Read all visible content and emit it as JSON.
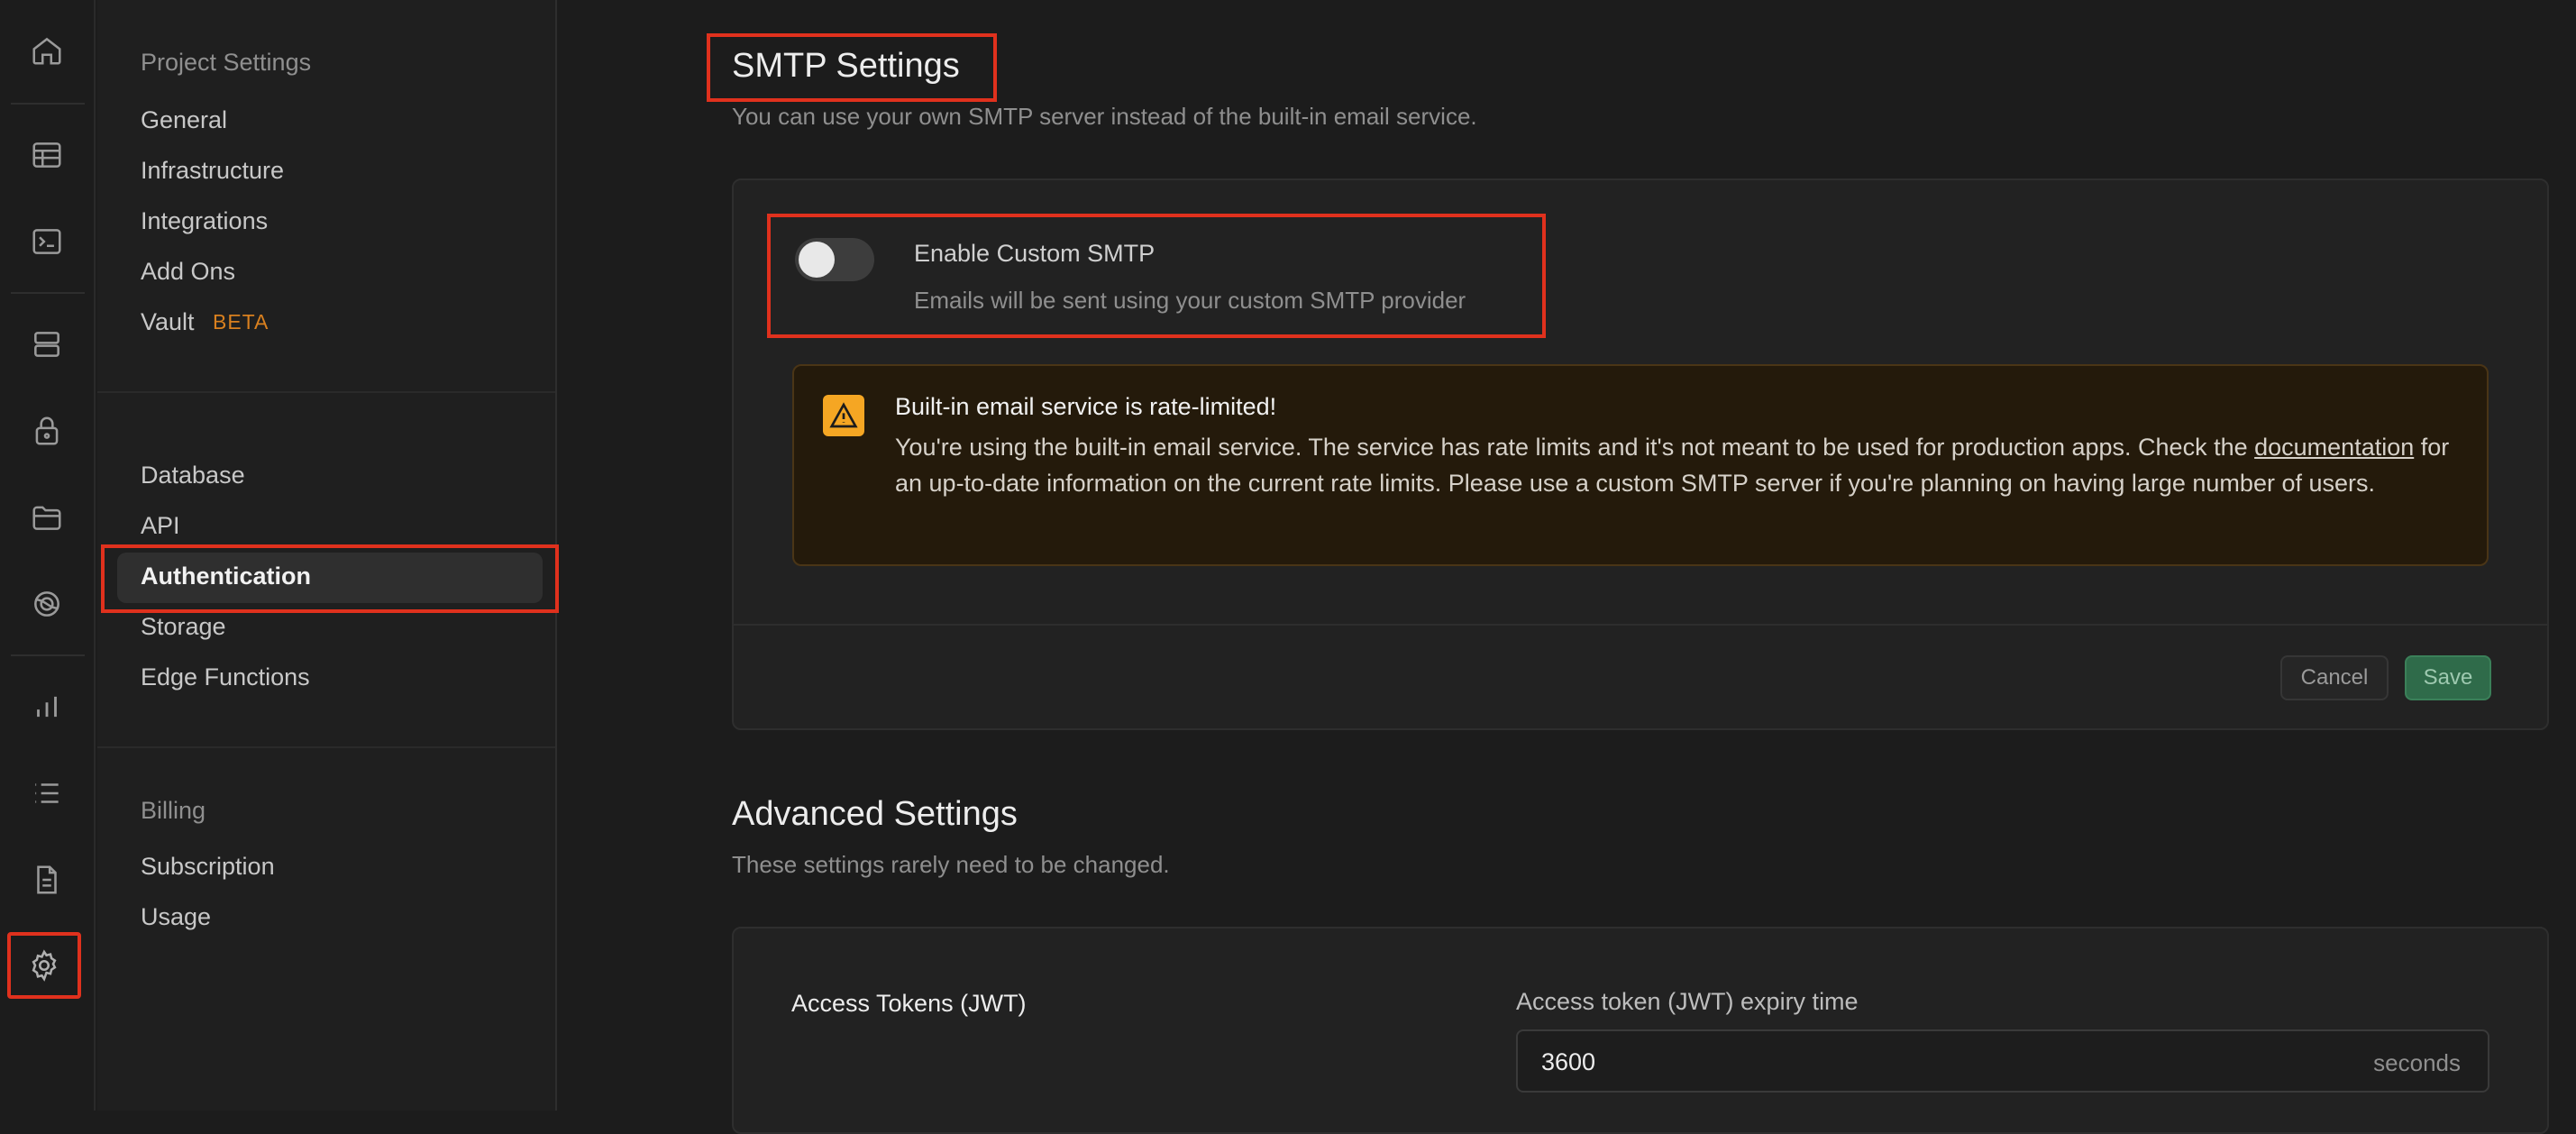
{
  "rail": {
    "items": [
      {
        "name": "home-icon"
      },
      {
        "name": "table-editor-icon"
      },
      {
        "name": "sql-editor-icon"
      },
      {
        "name": "database-icon"
      },
      {
        "name": "auth-lock-icon"
      },
      {
        "name": "storage-folder-icon"
      },
      {
        "name": "edge-functions-icon"
      },
      {
        "name": "reports-chart-icon"
      },
      {
        "name": "logs-list-icon"
      },
      {
        "name": "docs-file-icon"
      },
      {
        "name": "gear-icon"
      }
    ]
  },
  "menu": {
    "project_settings": {
      "title": "Project Settings",
      "items": [
        "General",
        "Infrastructure",
        "Integrations",
        "Add Ons",
        "Vault"
      ],
      "vault_badge": "BETA"
    },
    "configuration": {
      "items": [
        "Database",
        "API",
        "Authentication",
        "Storage",
        "Edge Functions"
      ],
      "active": "Authentication"
    },
    "billing": {
      "title": "Billing",
      "items": [
        "Subscription",
        "Usage"
      ]
    }
  },
  "smtp": {
    "title": "SMTP Settings",
    "subtitle": "You can use your own SMTP server instead of the built-in email service.",
    "toggle_label": "Enable Custom SMTP",
    "toggle_description": "Emails will be sent using your custom SMTP provider",
    "toggle_on": false,
    "alert": {
      "title": "Built-in email service is rate-limited!",
      "body_before_link": "You're using the built-in email service. The service has rate limits and it's not meant to be used for production apps. Check the ",
      "link": "documentation",
      "body_after_link": " for an up-to-date information on the current rate limits. Please use a custom SMTP server if you're planning on having large number of users."
    },
    "cancel_label": "Cancel",
    "save_label": "Save"
  },
  "advanced": {
    "title": "Advanced Settings",
    "subtitle": "These settings rarely need to be changed.",
    "section_label": "Access Tokens (JWT)",
    "expiry_label": "Access token (JWT) expiry time",
    "expiry_value": "3600",
    "expiry_unit": "seconds"
  },
  "colors": {
    "highlight": "#e0311d",
    "accent_beta": "#d9801f",
    "warning": "#f5a623",
    "save_green": "#2f6b4a"
  }
}
